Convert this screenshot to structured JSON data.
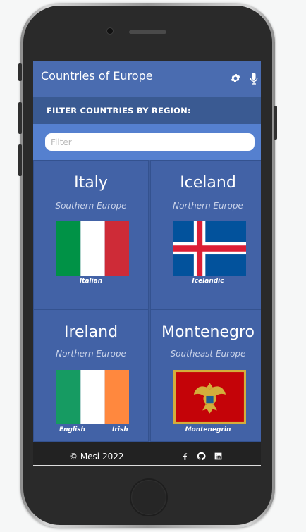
{
  "app": {
    "title": "Countries of Europe"
  },
  "filter": {
    "heading": "FILTER COUNTRIES BY REGION:",
    "placeholder": "Filter",
    "value": ""
  },
  "countries": [
    {
      "name": "Italy",
      "region": "Southern Europe",
      "languages": [
        "Italian"
      ],
      "flag": "italy-flag"
    },
    {
      "name": "Iceland",
      "region": "Northern Europe",
      "languages": [
        "Icelandic"
      ],
      "flag": "iceland-flag"
    },
    {
      "name": "Ireland",
      "region": "Northern Europe",
      "languages": [
        "English",
        "Irish"
      ],
      "flag": "ireland-flag"
    },
    {
      "name": "Montenegro",
      "region": "Southeast Europe",
      "languages": [
        "Montenegrin"
      ],
      "flag": "montenegro-flag"
    }
  ],
  "footer": {
    "copyright": "© Mesi 2022",
    "icons": [
      "facebook-icon",
      "github-icon",
      "linkedin-icon"
    ]
  },
  "icons": {
    "header": [
      "gear-icon",
      "microphone-icon"
    ]
  },
  "colors": {
    "header": "#4a6cb0",
    "filter_bar": "#3a5a92",
    "search_bar": "#5580cf",
    "card": "#4262a6",
    "footer": "#222222"
  }
}
